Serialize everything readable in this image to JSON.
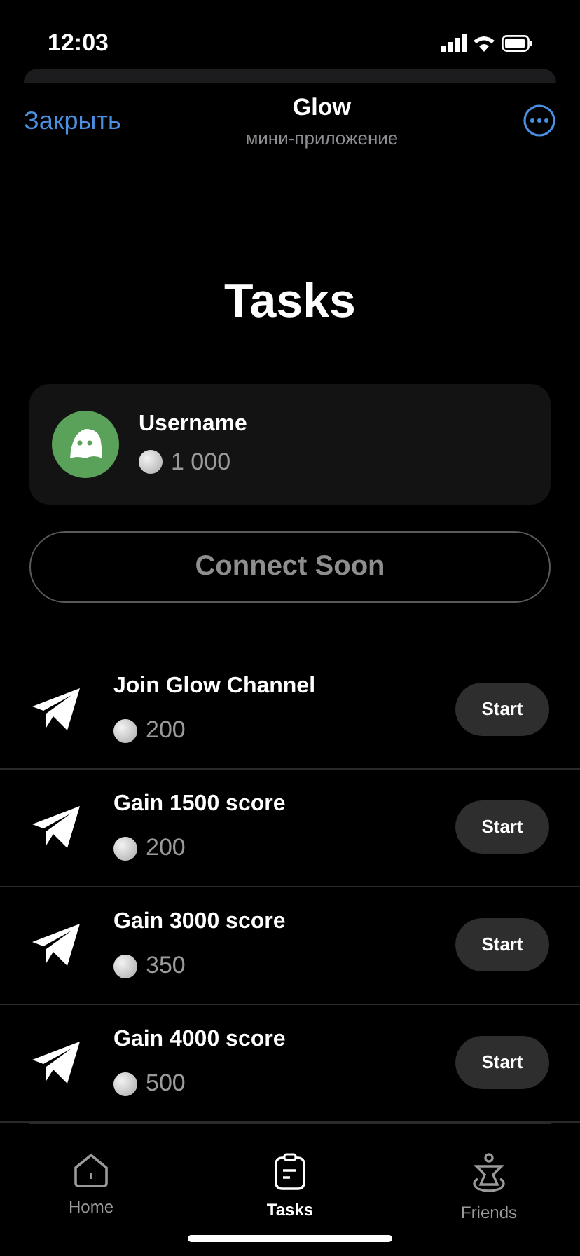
{
  "status_bar": {
    "time": "12:03"
  },
  "header": {
    "close": "Закрыть",
    "title": "Glow",
    "subtitle": "мини-приложение"
  },
  "page_title": "Tasks",
  "profile": {
    "name": "Username",
    "balance": "1 000"
  },
  "connect_button": {
    "label": "Connect Soon",
    "disabled": true
  },
  "tasks": [
    {
      "title": "Join Glow Channel",
      "reward": "200",
      "button": "Start"
    },
    {
      "title": "Gain 1500 score",
      "reward": "200",
      "button": "Start"
    },
    {
      "title": "Gain 3000 score",
      "reward": "350",
      "button": "Start"
    },
    {
      "title": "Gain 4000 score",
      "reward": "500",
      "button": "Start"
    }
  ],
  "nav": [
    {
      "label": "Home",
      "kind": "home",
      "selected": false
    },
    {
      "label": "Tasks",
      "kind": "tasks",
      "selected": true
    },
    {
      "label": "Friends",
      "kind": "friends",
      "selected": false
    }
  ]
}
